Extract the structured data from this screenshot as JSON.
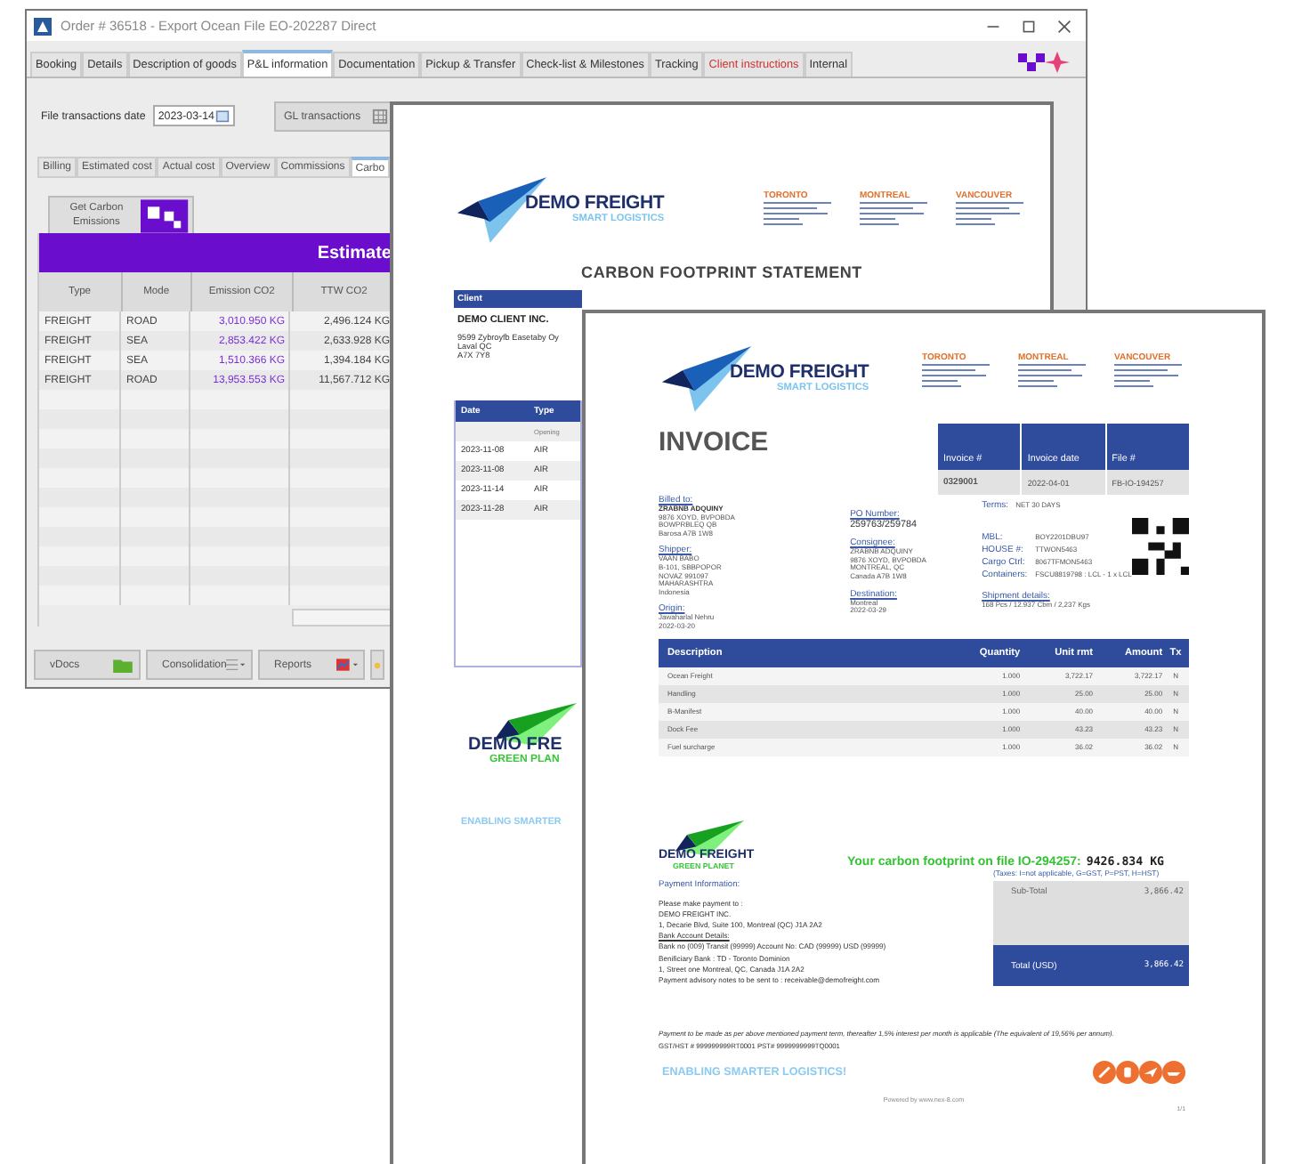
{
  "app": {
    "title": "Order # 36518 - Export Ocean File EO-202287 Direct",
    "tabs": [
      {
        "label": "Booking",
        "selected": false,
        "kind": "normal"
      },
      {
        "label": "Details",
        "selected": false,
        "kind": "normal"
      },
      {
        "label": "Description of goods",
        "selected": false,
        "kind": "normal"
      },
      {
        "label": "P&L information",
        "selected": true,
        "kind": "normal"
      },
      {
        "label": "Documentation",
        "selected": false,
        "kind": "normal"
      },
      {
        "label": "Pickup & Transfer",
        "selected": false,
        "kind": "normal"
      },
      {
        "label": "Check-list & Milestones",
        "selected": false,
        "kind": "normal"
      },
      {
        "label": "Tracking",
        "selected": false,
        "kind": "normal"
      },
      {
        "label": "Client instructions",
        "selected": false,
        "kind": "alert"
      },
      {
        "label": "Internal",
        "selected": false,
        "kind": "normal"
      }
    ],
    "date_label": "File transactions date",
    "date_value": "2023-03-14",
    "gl_button": "GL transactions",
    "subtabs": [
      {
        "label": "Billing",
        "selected": false
      },
      {
        "label": "Estimated cost",
        "selected": false
      },
      {
        "label": "Actual cost",
        "selected": false
      },
      {
        "label": "Overview",
        "selected": false
      },
      {
        "label": "Commissions",
        "selected": false
      },
      {
        "label": "Carbo",
        "selected": true
      }
    ],
    "emissions_button": "Get Carbon Emissions",
    "banner": "Estimate",
    "columns": [
      {
        "label": "Type",
        "kind": "plain"
      },
      {
        "label": "Mode",
        "kind": "plain"
      },
      {
        "label": "Emission CO2",
        "kind": "emphasis"
      },
      {
        "label": "TTW CO2",
        "kind": "plain"
      }
    ],
    "rows": [
      [
        "FREIGHT",
        "ROAD",
        "3,010.950 KG",
        "2,496.124 KG"
      ],
      [
        "FREIGHT",
        "SEA",
        "2,853.422 KG",
        "2,633.928 KG"
      ],
      [
        "FREIGHT",
        "SEA",
        "1,510.366 KG",
        "1,394.184 KG"
      ],
      [
        "FREIGHT",
        "ROAD",
        "13,953.553 KG",
        "11,567.712 KG"
      ]
    ],
    "bottom_buttons": [
      "vDocs",
      "Consolidation",
      "Reports"
    ]
  },
  "statement": {
    "company": "DEMO FREIGHT",
    "tagline": "SMART LOGISTICS",
    "offices": [
      "TORONTO",
      "MONTREAL",
      "VANCOUVER"
    ],
    "title": "CARBON FOOTPRINT STATEMENT",
    "client_header": "Client",
    "client_name": "DEMO CLIENT INC.",
    "client_address": [
      "9599 Zybroyfb Easetaby Oy",
      "Laval QC",
      "A7X 7Y8"
    ],
    "columns": [
      "Date",
      "Type"
    ],
    "rows": [
      {
        "date": "",
        "type": "Opening"
      },
      {
        "date": "2023-11-08",
        "type": "AIR"
      },
      {
        "date": "2023-11-08",
        "type": "AIR"
      },
      {
        "date": "2023-11-14",
        "type": "AIR"
      },
      {
        "date": "2023-11-28",
        "type": "AIR"
      }
    ],
    "footer_company": "DEMO FRE",
    "footer_tagline": "GREEN PLAN",
    "slogan": "ENABLING SMARTER"
  },
  "invoice": {
    "company": "DEMO FREIGHT",
    "tagline": "SMART LOGISTICS",
    "offices": [
      "TORONTO",
      "MONTREAL",
      "VANCOUVER"
    ],
    "title": "INVOICE",
    "header": [
      {
        "label": "Invoice #",
        "value": "0329001"
      },
      {
        "label": "Invoice date",
        "value": "2022-04-01"
      },
      {
        "label": "File #",
        "value": "FB-IO-194257"
      }
    ],
    "left": [
      {
        "label": "Billed to:",
        "lines": [
          "ZRABNB ADQUINY",
          "9876 XOYD, BVPOBDA",
          "BOWPRBLEQ QB",
          "Barosa A7B 1W8"
        ]
      },
      {
        "label": "Shipper:",
        "lines": [
          "VAAN BABO",
          "B-101, SBBPOPOR",
          "NOVAZ 991097",
          "MAHARASHTRA",
          "Indonesia"
        ]
      },
      {
        "label": "Origin:",
        "lines": [
          "Jawaharlal Nehru",
          "2022-03-20"
        ]
      }
    ],
    "middle": [
      {
        "label": "PO Number:",
        "lines": [
          "259763/259784"
        ]
      },
      {
        "label": "Consignee:",
        "lines": [
          "ZRABNB ADQUINY",
          "9876 XOYD, BVPOBDA",
          "MONTREAL, QC",
          "Canada A7B 1W8"
        ]
      },
      {
        "label": "Destination:",
        "lines": [
          "Montreal",
          "2022-03-29"
        ]
      }
    ],
    "terms": {
      "label": "Terms:",
      "value": "NET 30 DAYS"
    },
    "refs": [
      {
        "label": "MBL:",
        "value": "BOY2201DBU97"
      },
      {
        "label": "HOUSE #:",
        "value": "TTWON5463"
      },
      {
        "label": "Cargo Ctrl:",
        "value": "8067TFMON5463"
      },
      {
        "label": "Containers:",
        "value": "FSCU8819798 : LCL - 1 x LCL"
      }
    ],
    "shipment": {
      "label": "Shipment details:",
      "value": "168 Pcs / 12.937 Cbm / 2,237 Kgs"
    },
    "columns": [
      "Description",
      "Quantity",
      "Unit rmt",
      "Amount",
      "Tx"
    ],
    "lines": [
      [
        "Ocean Freight",
        "1.000",
        "3,722.17",
        "3,722.17",
        "N"
      ],
      [
        "Handling",
        "1.000",
        "25.00",
        "25.00",
        "N"
      ],
      [
        "B-Manifest",
        "1.000",
        "40.00",
        "40.00",
        "N"
      ],
      [
        "Dock Fee",
        "1.000",
        "43.23",
        "43.23",
        "N"
      ],
      [
        "Fuel surcharge",
        "1.000",
        "36.02",
        "36.02",
        "N"
      ]
    ],
    "green_company": "DEMO FREIGHT",
    "green_tagline": "GREEN PLANET",
    "footprint_label": "Your carbon footprint on file IO-294257:",
    "footprint_value": "9426.834 KG",
    "payment_title": "Payment Information:",
    "payment_lines": [
      {
        "text": "Please make payment to :",
        "kind": "plain"
      },
      {
        "text": "DEMO FREIGHT INC.",
        "kind": "plain"
      },
      {
        "text": "1, Decarie Blvd, Suite 100, Montreal (QC) J1A 2A2",
        "kind": "plain"
      },
      {
        "text": "Bank Account Details:",
        "kind": "underline"
      },
      {
        "text": "Bank no (009) Transit (99999) Account No: CAD (99999) USD (99999)",
        "kind": "plain"
      },
      {
        "text": "Benificiary Bank :  TD - Toronto Dominion",
        "kind": "plain"
      },
      {
        "text": "1, Street one  Montreal, QC, Canada  J1A 2A2",
        "kind": "plain"
      },
      {
        "text": "Payment advisory notes to be sent to : receivable@demofreight.com",
        "kind": "plain"
      }
    ],
    "taxes_note": "(Taxes: I=not applicable, G=GST, P=PST, H=HST)",
    "subtotal_label": "Sub-Total",
    "subtotal": "3,866.42",
    "total_label": "Total (USD)",
    "total": "3,866.42",
    "terms_note": "Payment to be made as per above mentioned payment term, thereafter 1,5% interest per month is applicable (The equivalent of 19,56% per annum).",
    "tax_ids": "GST/HST # 999999999RT0001  PST# 9999999999TQ0001",
    "slogan": "ENABLING SMARTER LOGISTICS!",
    "powered": "Powered by www.nex-8.com",
    "page": "1/1"
  }
}
